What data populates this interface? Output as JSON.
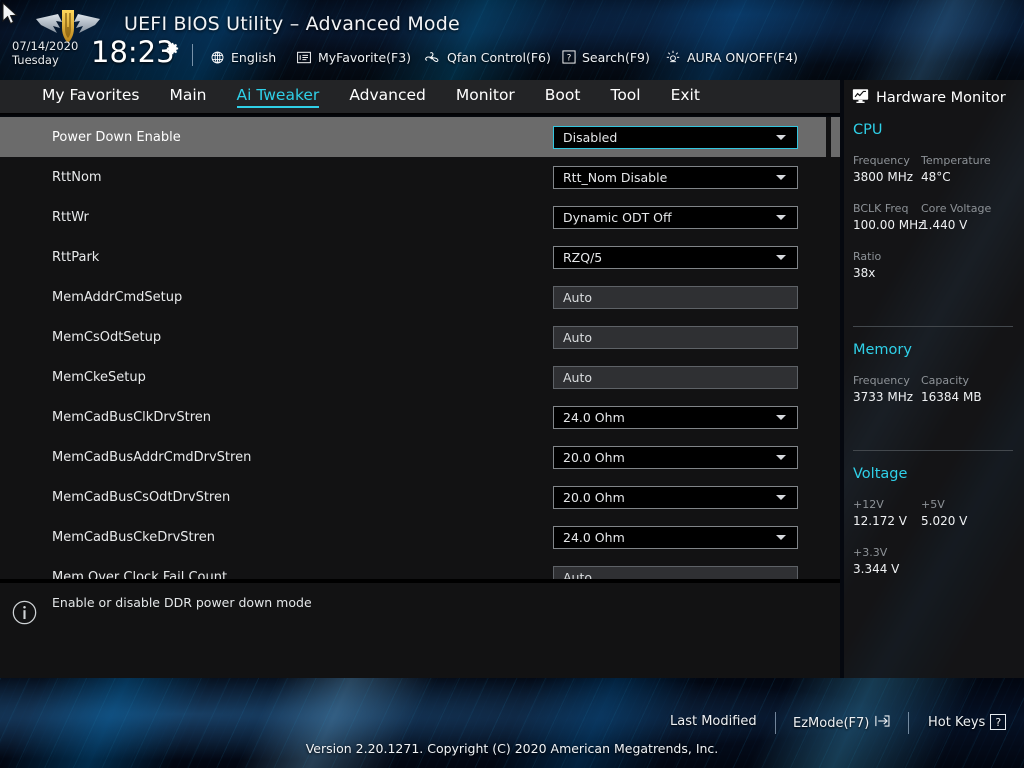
{
  "header": {
    "title": "UEFI BIOS Utility – Advanced Mode",
    "date": "07/14/2020",
    "weekday": "Tuesday",
    "time": "18:23",
    "logo_name": "tuf-gaming-logo",
    "items": [
      {
        "label": "English",
        "icon": "globe-icon"
      },
      {
        "label": "MyFavorite(F3)",
        "icon": "list-icon"
      },
      {
        "label": "Qfan Control(F6)",
        "icon": "fan-icon"
      },
      {
        "label": "Search(F9)",
        "icon": "question-box-icon"
      },
      {
        "label": "AURA ON/OFF(F4)",
        "icon": "aura-light-icon"
      }
    ]
  },
  "tabs": [
    {
      "label": "My Favorites",
      "active": false
    },
    {
      "label": "Main",
      "active": false
    },
    {
      "label": "Ai Tweaker",
      "active": true
    },
    {
      "label": "Advanced",
      "active": false
    },
    {
      "label": "Monitor",
      "active": false
    },
    {
      "label": "Boot",
      "active": false
    },
    {
      "label": "Tool",
      "active": false
    },
    {
      "label": "Exit",
      "active": false
    }
  ],
  "settings": [
    {
      "label": "Power Down Enable",
      "value": "Disabled",
      "type": "dropdown",
      "selected": true,
      "partial": false
    },
    {
      "label": "RttNom",
      "value": "Rtt_Nom Disable",
      "type": "dropdown",
      "selected": false,
      "partial": false
    },
    {
      "label": "RttWr",
      "value": "Dynamic ODT Off",
      "type": "dropdown",
      "selected": false,
      "partial": false
    },
    {
      "label": "RttPark",
      "value": "RZQ/5",
      "type": "dropdown",
      "selected": false,
      "partial": false
    },
    {
      "label": "MemAddrCmdSetup",
      "value": "Auto",
      "type": "readonly",
      "selected": false,
      "partial": false
    },
    {
      "label": "MemCsOdtSetup",
      "value": "Auto",
      "type": "readonly",
      "selected": false,
      "partial": false
    },
    {
      "label": "MemCkeSetup",
      "value": "Auto",
      "type": "readonly",
      "selected": false,
      "partial": false
    },
    {
      "label": "MemCadBusClkDrvStren",
      "value": "24.0 Ohm",
      "type": "dropdown",
      "selected": false,
      "partial": false
    },
    {
      "label": "MemCadBusAddrCmdDrvStren",
      "value": "20.0 Ohm",
      "type": "dropdown",
      "selected": false,
      "partial": false
    },
    {
      "label": "MemCadBusCsOdtDrvStren",
      "value": "20.0 Ohm",
      "type": "dropdown",
      "selected": false,
      "partial": false
    },
    {
      "label": "MemCadBusCkeDrvStren",
      "value": "24.0 Ohm",
      "type": "dropdown",
      "selected": false,
      "partial": false
    },
    {
      "label": "Mem Over Clock Fail Count",
      "value": "Auto",
      "type": "readonly",
      "selected": false,
      "partial": true
    }
  ],
  "help": {
    "icon": "info-icon",
    "text": "Enable or disable DDR power down mode"
  },
  "hardware_monitor": {
    "title": "Hardware Monitor",
    "icon": "monitor-icon",
    "sections": [
      {
        "name": "CPU",
        "rows": [
          [
            {
              "key": "Frequency",
              "value": "3800 MHz"
            },
            {
              "key": "Temperature",
              "value": "48°C"
            }
          ],
          [
            {
              "key": "BCLK Freq",
              "value": "100.00 MHz"
            },
            {
              "key": "Core Voltage",
              "value": "1.440 V"
            }
          ],
          [
            {
              "key": "Ratio",
              "value": "38x"
            }
          ]
        ]
      },
      {
        "name": "Memory",
        "rows": [
          [
            {
              "key": "Frequency",
              "value": "3733 MHz"
            },
            {
              "key": "Capacity",
              "value": "16384 MB"
            }
          ]
        ]
      },
      {
        "name": "Voltage",
        "rows": [
          [
            {
              "key": "+12V",
              "value": "12.172 V"
            },
            {
              "key": "+5V",
              "value": "5.020 V"
            }
          ],
          [
            {
              "key": "+3.3V",
              "value": "3.344 V"
            }
          ]
        ]
      }
    ]
  },
  "footer": {
    "last_modified": "Last Modified",
    "ezmode": "EzMode(F7)",
    "ezmode_icon": "exit-arrow-icon",
    "hotkeys": "Hot Keys",
    "hotkeys_key": "?",
    "version": "Version 2.20.1271. Copyright (C) 2020 American Megatrends, Inc."
  },
  "colors": {
    "accent_cyan": "#2fd0e8",
    "selected_row": "#6b6b6b",
    "panel_bg": "#121213",
    "hw_bg": "#141416",
    "tabbar_bg": "#232426"
  }
}
